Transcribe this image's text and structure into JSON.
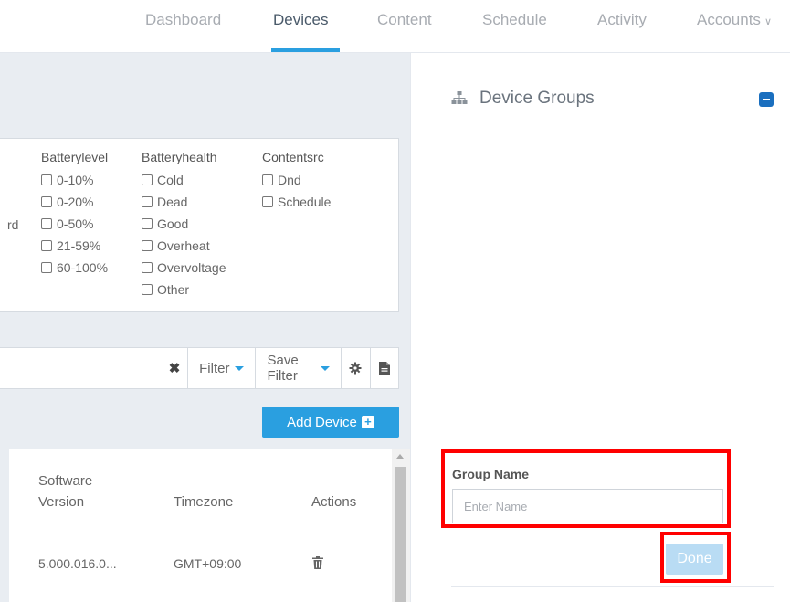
{
  "nav": {
    "items": [
      {
        "label": "Dashboard"
      },
      {
        "label": "Devices"
      },
      {
        "label": "Content"
      },
      {
        "label": "Schedule"
      },
      {
        "label": "Activity"
      },
      {
        "label": "Accounts"
      }
    ],
    "active": "Devices"
  },
  "filters": {
    "partial_label": "rd",
    "columns": [
      {
        "header": "Batterylevel",
        "options": [
          "0-10%",
          "0-20%",
          "0-50%",
          "21-59%",
          "60-100%"
        ]
      },
      {
        "header": "Batteryhealth",
        "options": [
          "Cold",
          "Dead",
          "Good",
          "Overheat",
          "Overvoltage",
          "Other"
        ]
      },
      {
        "header": "Contentsrc",
        "options": [
          "Dnd",
          "Schedule"
        ]
      }
    ]
  },
  "toolbar": {
    "clear_glyph": "✖",
    "filter_label": "Filter",
    "save_filter_label": "Save Filter"
  },
  "add_device": {
    "label": "Add Device"
  },
  "table": {
    "headers": {
      "software_version": "Software Version",
      "timezone": "Timezone",
      "actions": "Actions"
    },
    "rows": [
      {
        "software_version": "5.000.016.0...",
        "timezone": "GMT+09:00"
      }
    ]
  },
  "device_groups": {
    "title": "Device Groups",
    "group_name_label": "Group Name",
    "group_name_placeholder": "Enter Name",
    "group_name_value": "",
    "done_label": "Done"
  },
  "colors": {
    "accent": "#2a9fe0",
    "collapse": "#1a6fbf",
    "highlight": "#ff0000",
    "done_disabled": "#b9dcf4"
  },
  "icons": {
    "sitemap": "sitemap-icon",
    "collapse": "minus-square-icon",
    "settings": "gear-icon",
    "export": "document-icon",
    "delete": "trash-icon"
  }
}
